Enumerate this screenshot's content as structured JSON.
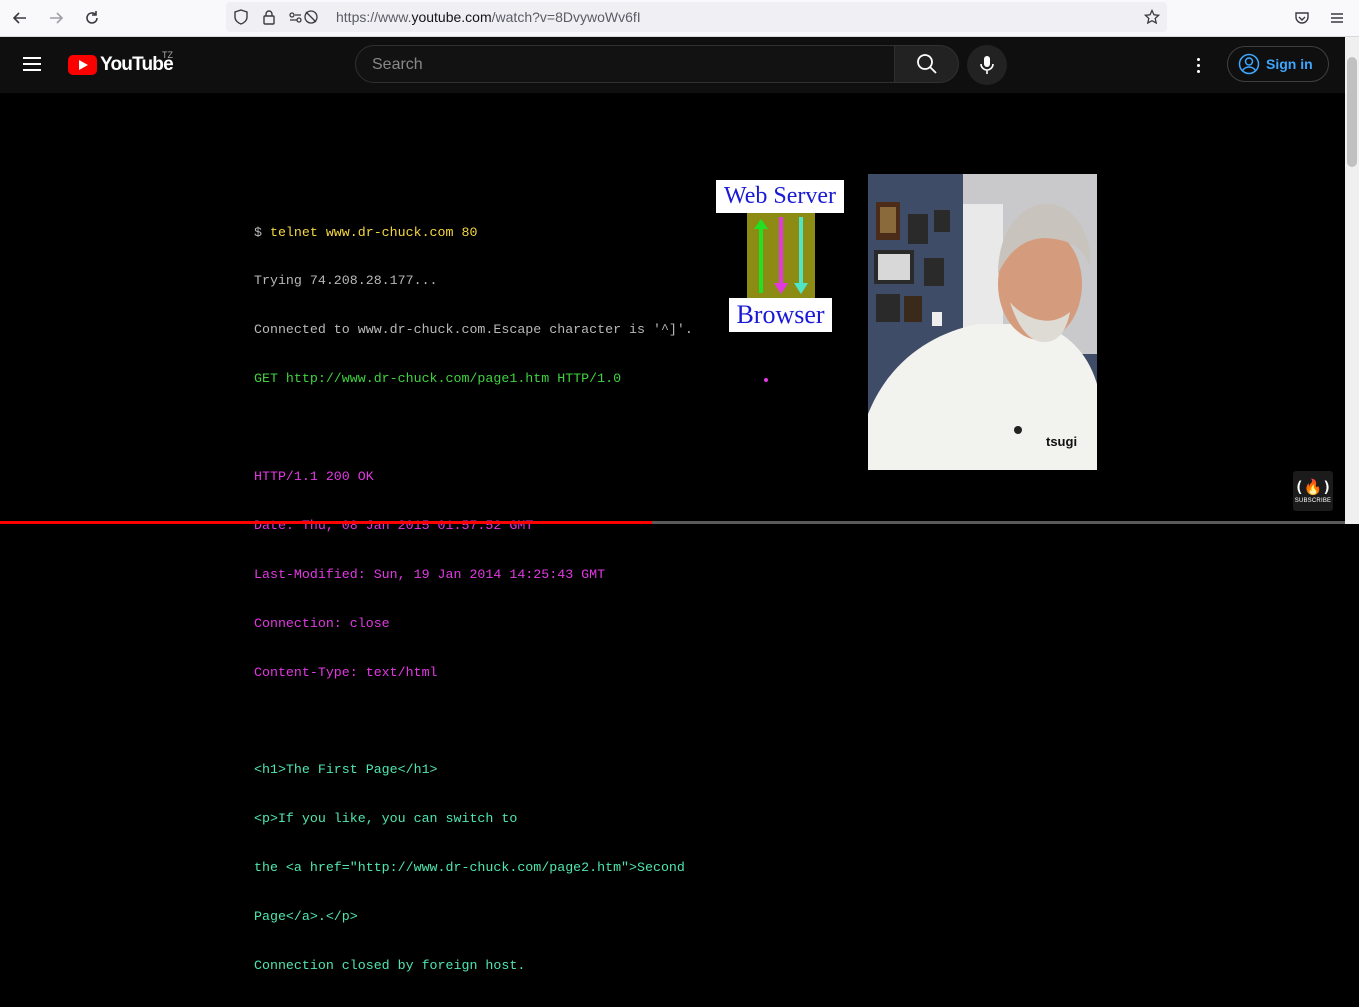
{
  "browser": {
    "url_prefix": "https://www.",
    "url_host": "youtube.com",
    "url_path": "/watch?v=8DvywoWv6fI",
    "icons": [
      "back-arrow-icon",
      "forward-arrow-icon",
      "reload-icon",
      "shield-icon",
      "lock-icon",
      "permissions-icon",
      "star-icon",
      "pocket-icon",
      "menu-icon"
    ]
  },
  "youtube": {
    "logo_text": "YouTube",
    "country_code": "TZ",
    "search_placeholder": "Search",
    "sign_in_label": "Sign in",
    "brand_color": "#ff0000",
    "link_color": "#3ea6ff"
  },
  "video": {
    "terminal_lines": [
      {
        "cls": "c-gray",
        "prefix": "$ ",
        "text": "telnet www.dr-chuck.com 80",
        "text_cls": "c-yellow"
      },
      {
        "cls": "c-gray",
        "text": "Trying 74.208.28.177..."
      },
      {
        "cls": "c-gray",
        "text": "Connected to www.dr-chuck.com.Escape character is '^]'."
      },
      {
        "cls": "c-green",
        "text": "GET http://www.dr-chuck.com/page1.htm HTTP/1.0"
      },
      {
        "cls": "c-gray",
        "text": ""
      },
      {
        "cls": "c-magenta",
        "text": "HTTP/1.1 200 OK"
      },
      {
        "cls": "c-magenta",
        "text": "Date: Thu, 08 Jan 2015 01:57:52 GMT"
      },
      {
        "cls": "c-magenta",
        "text": "Last-Modified: Sun, 19 Jan 2014 14:25:43 GMT"
      },
      {
        "cls": "c-magenta",
        "text": "Connection: close"
      },
      {
        "cls": "c-magenta",
        "text": "Content-Type: text/html"
      },
      {
        "cls": "c-gray",
        "text": ""
      },
      {
        "cls": "c-teal",
        "text": "<h1>The First Page</h1>"
      },
      {
        "cls": "c-teal",
        "text": "<p>If you like, you can switch to"
      },
      {
        "cls": "c-teal",
        "text": "the <a href=\"http://www.dr-chuck.com/page2.htm\">Second"
      },
      {
        "cls": "c-teal",
        "text": "Page</a>.</p>"
      },
      {
        "cls": "c-teal",
        "text": "Connection closed by foreign host."
      }
    ],
    "diagram_top_label": "Web Server",
    "diagram_bottom_label": "Browser",
    "arrow_colors": [
      "#22e022",
      "#e238e2",
      "#4fe6c8"
    ],
    "shirt_logo_text": "tsugi",
    "subscribe_glyph": "(🔥)",
    "subscribe_label": "SUBSCRIBE",
    "progress_fraction": 0.485
  }
}
